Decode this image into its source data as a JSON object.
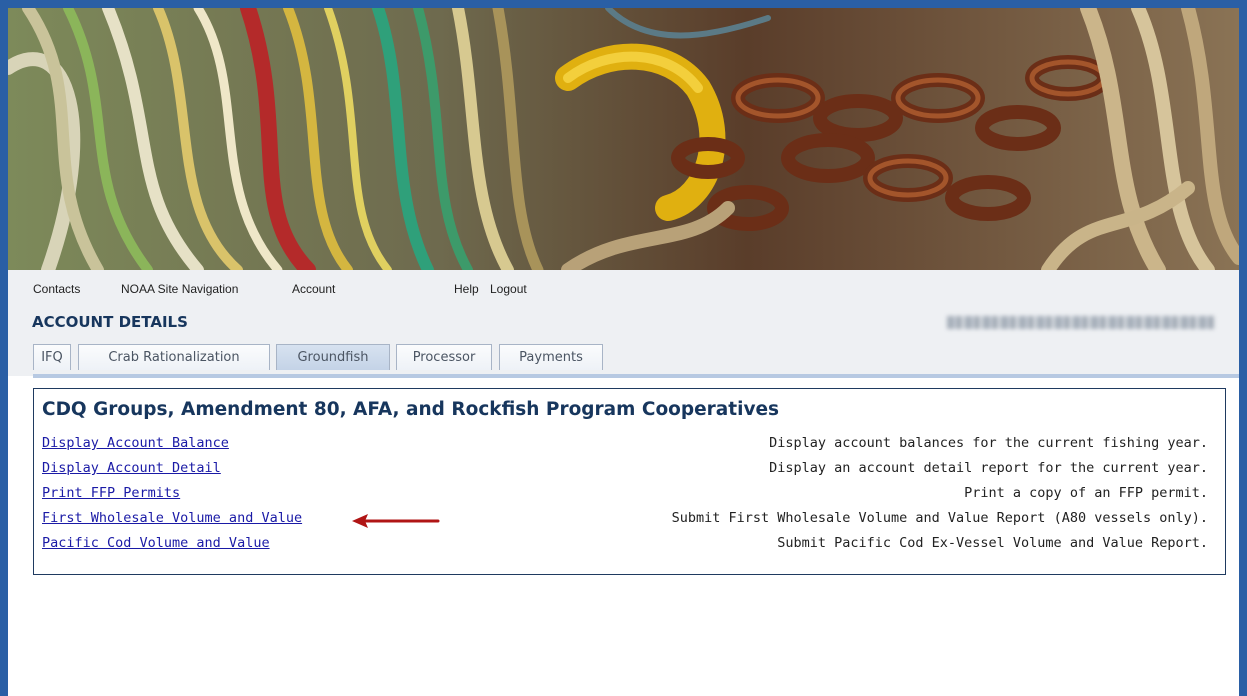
{
  "nav": {
    "items": [
      "Contacts",
      "NOAA Site Navigation",
      "Account",
      "Help",
      "Logout"
    ]
  },
  "account": {
    "title": "ACCOUNT DETAILS"
  },
  "tabs": [
    {
      "label": "IFQ",
      "active": false
    },
    {
      "label": "Crab Rationalization",
      "active": false
    },
    {
      "label": "Groundfish",
      "active": true
    },
    {
      "label": "Processor",
      "active": false
    },
    {
      "label": "Payments",
      "active": false
    }
  ],
  "panel": {
    "title": "CDQ Groups, Amendment 80, AFA, and Rockfish Program Cooperatives",
    "rows": [
      {
        "link": "Display Account Balance",
        "desc": "Display account balances for the current fishing year."
      },
      {
        "link": "Display Account Detail",
        "desc": "Display an account detail report for the current year."
      },
      {
        "link": "Print FFP Permits",
        "desc": "Print a copy of an FFP permit."
      },
      {
        "link": "First Wholesale Volume and Value",
        "desc": "Submit First Wholesale Volume and Value Report (A80 vessels only)."
      },
      {
        "link": "Pacific Cod Volume and Value",
        "desc": "Submit Pacific Cod Ex-Vessel Volume and Value Report."
      }
    ]
  },
  "colors": {
    "frame": "#2a5fa5",
    "heading": "#17365d",
    "link": "#1a1aa6",
    "arrow": "#b01515"
  },
  "icons": {
    "callout": "red-arrow-icon"
  }
}
